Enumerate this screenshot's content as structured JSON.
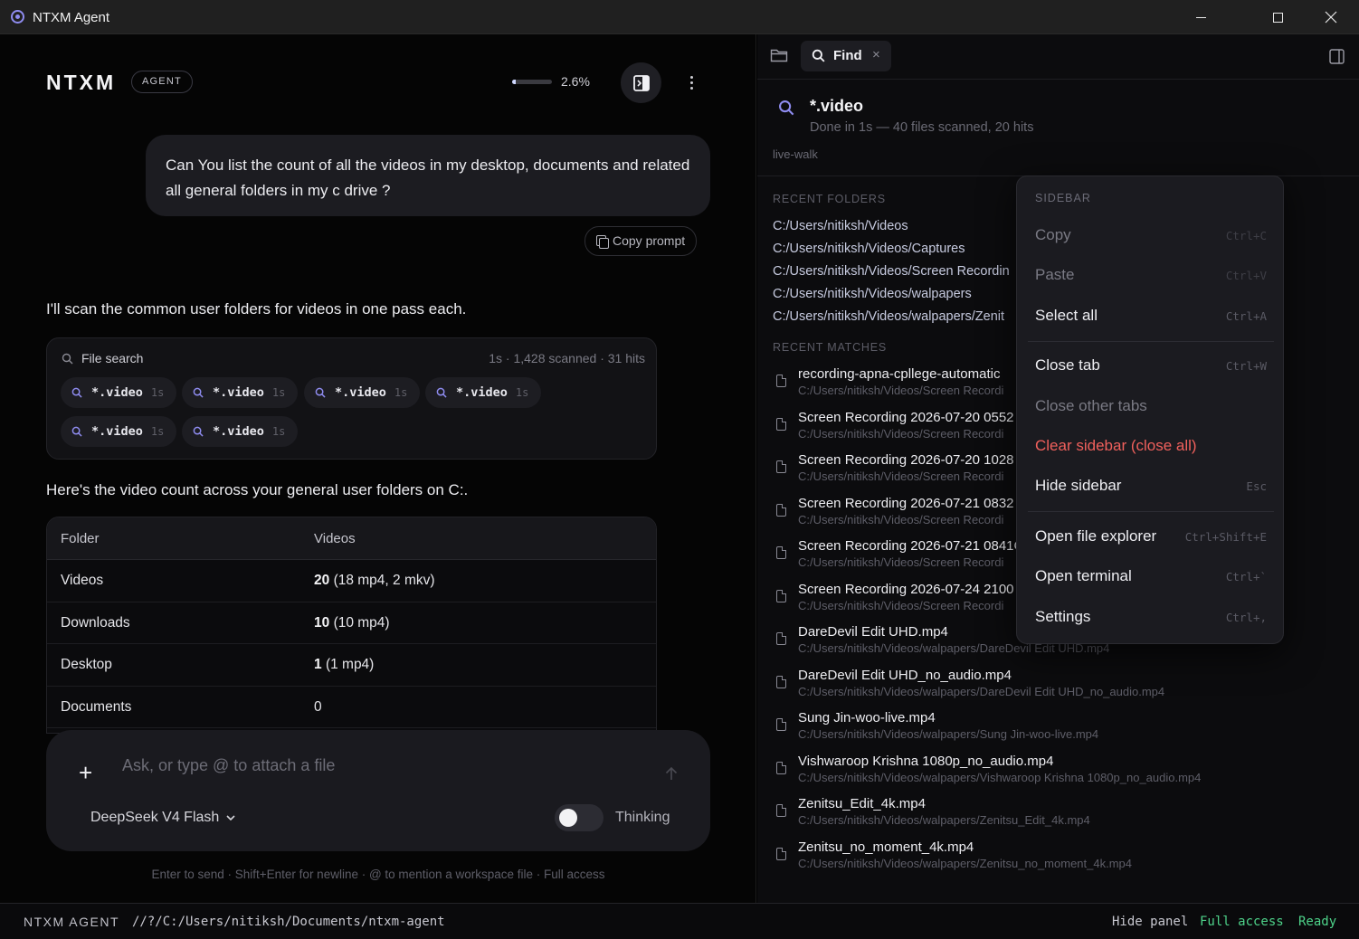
{
  "window": {
    "title": "NTXM Agent"
  },
  "header": {
    "logo": "NTXM",
    "badge": "AGENT",
    "progress_text": "2.6%",
    "progress_fraction": 0.026
  },
  "chat": {
    "user_message": "Can You list the count of all the videos in my desktop, documents and related all general folders in my c drive ?",
    "copy_prompt": "Copy prompt",
    "assistant_intro": "I'll scan the common user folders for videos in one pass each.",
    "search_card": {
      "title": "File search",
      "stats": "1s · 1,428 scanned · 31 hits",
      "chips": [
        {
          "label": "*.video",
          "time": "1s"
        },
        {
          "label": "*.video",
          "time": "1s"
        },
        {
          "label": "*.video",
          "time": "1s"
        },
        {
          "label": "*.video",
          "time": "1s"
        },
        {
          "label": "*.video",
          "time": "1s"
        },
        {
          "label": "*.video",
          "time": "1s"
        }
      ]
    },
    "summary": "Here's the video count across your general user folders on C:.",
    "table": {
      "headers": [
        "Folder",
        "Videos"
      ],
      "rows": [
        {
          "folder": "Videos",
          "count": "20",
          "detail": "(18 mp4, 2 mkv)"
        },
        {
          "folder": "Downloads",
          "count": "10",
          "detail": "(10 mp4)"
        },
        {
          "folder": "Desktop",
          "count": "1",
          "detail": "(1 mp4)"
        },
        {
          "folder": "Documents",
          "count": "",
          "detail": "0"
        }
      ]
    }
  },
  "composer": {
    "placeholder": "Ask, or type @ to attach a file",
    "model": "DeepSeek V4 Flash",
    "thinking_label": "Thinking",
    "hint": "Enter to send · Shift+Enter for newline · @ to mention a workspace file · Full access"
  },
  "sidebar": {
    "tab_label": "Find",
    "query": "*.video",
    "status": "Done in 1s — 40 files scanned, 20 hits",
    "mode": "live-walk",
    "recent_folders_label": "RECENT FOLDERS",
    "recent_folders": [
      "C:/Users/nitiksh/Videos",
      "C:/Users/nitiksh/Videos/Captures",
      "C:/Users/nitiksh/Videos/Screen Recordin",
      "C:/Users/nitiksh/Videos/walpapers",
      "C:/Users/nitiksh/Videos/walpapers/Zenit"
    ],
    "recent_matches_label": "RECENT MATCHES",
    "matches": [
      {
        "name": "recording-apna-cpllege-automatic",
        "path": "C:/Users/nitiksh/Videos/Screen Recordi"
      },
      {
        "name": "Screen Recording 2026-07-20 0552",
        "path": "C:/Users/nitiksh/Videos/Screen Recordi"
      },
      {
        "name": "Screen Recording 2026-07-20 1028",
        "path": "C:/Users/nitiksh/Videos/Screen Recordi"
      },
      {
        "name": "Screen Recording 2026-07-21 0832",
        "path": "C:/Users/nitiksh/Videos/Screen Recordi"
      },
      {
        "name": "Screen Recording 2026-07-21 0841C",
        "path": "C:/Users/nitiksh/Videos/Screen Recordi"
      },
      {
        "name": "Screen Recording 2026-07-24 2100",
        "path": "C:/Users/nitiksh/Videos/Screen Recordi"
      },
      {
        "name": "DareDevil Edit UHD.mp4",
        "path": "C:/Users/nitiksh/Videos/walpapers/DareDevil Edit UHD.mp4"
      },
      {
        "name": "DareDevil Edit UHD_no_audio.mp4",
        "path": "C:/Users/nitiksh/Videos/walpapers/DareDevil Edit UHD_no_audio.mp4"
      },
      {
        "name": "Sung Jin-woo-live.mp4",
        "path": "C:/Users/nitiksh/Videos/walpapers/Sung Jin-woo-live.mp4"
      },
      {
        "name": "Vishwaroop Krishna 1080p_no_audio.mp4",
        "path": "C:/Users/nitiksh/Videos/walpapers/Vishwaroop Krishna 1080p_no_audio.mp4"
      },
      {
        "name": "Zenitsu_Edit_4k.mp4",
        "path": "C:/Users/nitiksh/Videos/walpapers/Zenitsu_Edit_4k.mp4"
      },
      {
        "name": "Zenitsu_no_moment_4k.mp4",
        "path": "C:/Users/nitiksh/Videos/walpapers/Zenitsu_no_moment_4k.mp4"
      }
    ]
  },
  "context_menu": {
    "heading": "SIDEBAR",
    "items": [
      {
        "label": "Copy",
        "shortcut": "Ctrl+C"
      },
      {
        "label": "Paste",
        "shortcut": "Ctrl+V"
      },
      {
        "label": "Select all",
        "shortcut": "Ctrl+A"
      },
      {
        "label": "Close tab",
        "shortcut": "Ctrl+W"
      },
      {
        "label": "Close other tabs",
        "shortcut": ""
      },
      {
        "label": "Clear sidebar (close all)",
        "shortcut": ""
      },
      {
        "label": "Hide sidebar",
        "shortcut": "Esc"
      },
      {
        "label": "Open file explorer",
        "shortcut": "Ctrl+Shift+E"
      },
      {
        "label": "Open terminal",
        "shortcut": "Ctrl+`"
      },
      {
        "label": "Settings",
        "shortcut": "Ctrl+,"
      }
    ]
  },
  "statusbar": {
    "app": "NTXM AGENT",
    "path": "//?/C:/Users/nitiksh/Documents/ntxm-agent",
    "hide_panel": "Hide panel",
    "access": "Full access",
    "ready": "Ready"
  },
  "colors": {
    "accent": "#8f8cf0",
    "danger": "#f0605c",
    "status_ok": "#4ed38a"
  }
}
